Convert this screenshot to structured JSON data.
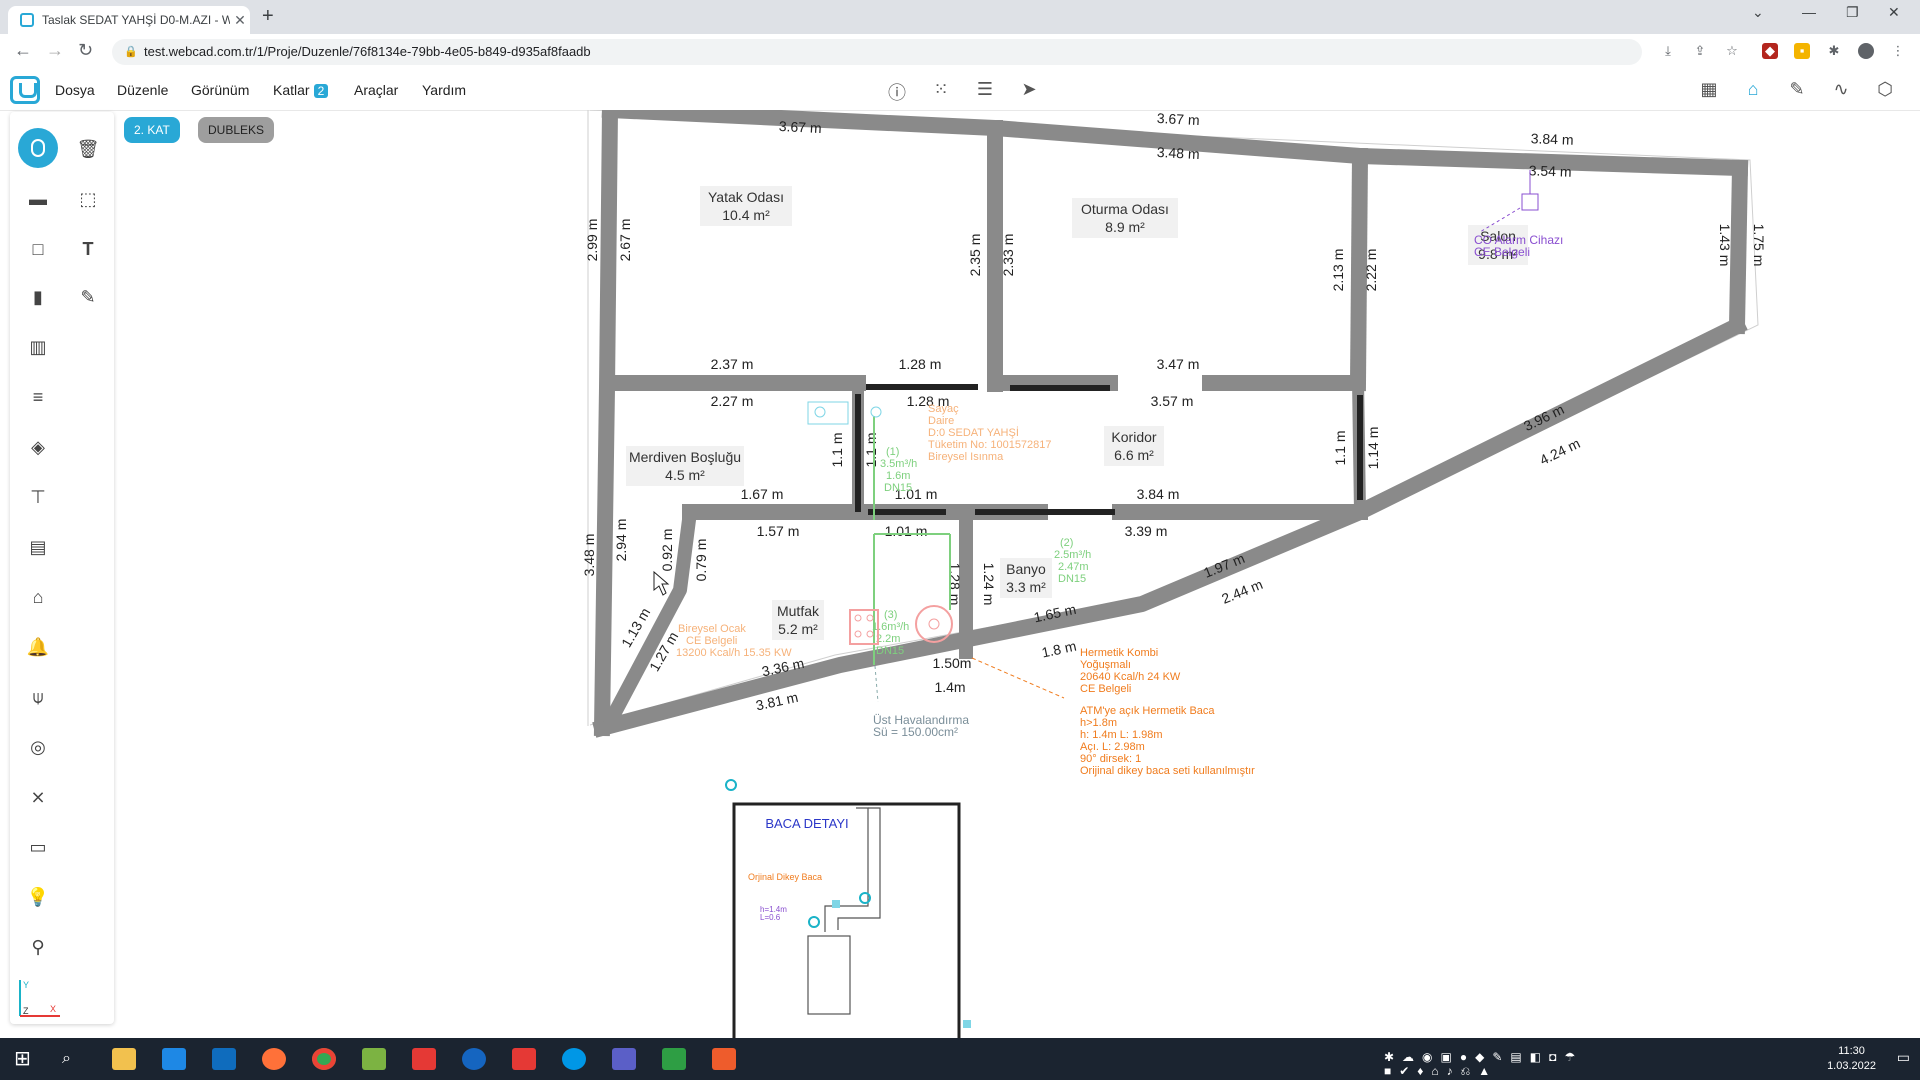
{
  "browser": {
    "tab_title": "Taslak SEDAT YAHŞİ D0-M.AZI - W",
    "new_tab": "+",
    "url": "test.webcad.com.tr/1/Proje/Duzenle/76f8134e-79bb-4e05-b849-d935af8faadb"
  },
  "menu": {
    "items": [
      "Dosya",
      "Düzenle",
      "Görünüm",
      "Katlar",
      "Araçlar",
      "Yardım"
    ],
    "katlar_badge": "2"
  },
  "floor_chips": {
    "active": "2. KAT",
    "other": "DUBLEKS"
  },
  "colors": {
    "accent": "#29a8d6",
    "wall": "#8a8a8a",
    "orange": "#f07c1e",
    "green": "#7ed07e",
    "purple": "#8a4fd0",
    "cyan": "#1ab3c8"
  },
  "rooms": {
    "yatak": {
      "name": "Yatak Odası",
      "area": "10.4 m²"
    },
    "oturma": {
      "name": "Oturma Odası",
      "area": "8.9 m²"
    },
    "salon": {
      "name": "Salon",
      "area": "9.8 m²"
    },
    "merdiven": {
      "name": "Merdiven Boşluğu",
      "area": "4.5 m²"
    },
    "koridor": {
      "name": "Koridor",
      "area": "6.6 m²"
    },
    "banyo": {
      "name": "Banyo",
      "area": "3.3 m²"
    },
    "mutfak": {
      "name": "Mutfak",
      "area": "5.2 m²"
    }
  },
  "dims": {
    "top1": "3.67 m",
    "top2": "3.67 m",
    "top3": "3.84 m",
    "in1": "3.48 m",
    "in2": "3.54 m",
    "mid1": "2.37 m",
    "mid2": "1.28 m",
    "mid3": "3.47 m",
    "mid4": "2.27 m",
    "mid5": "1.28 m",
    "mid6": "3.57 m",
    "low1": "1.67 m",
    "low2": "1.01 m",
    "low3": "3.84 m",
    "low4": "1.57 m",
    "low5": "1.01 m",
    "low6": "3.39 m",
    "v1": "2.99 m",
    "v2": "2.67 m",
    "v3": "2.35 m",
    "v4": "2.33 m",
    "v5": "2.13 m",
    "v6": "2.22 m",
    "v7": "1.43 m",
    "v8": "1.75 m",
    "v9": "1.1 m",
    "v10": "1.1 m",
    "v11": "1.1 m",
    "v12": "1.14 m",
    "v13": "3.48 m",
    "v14": "2.94 m",
    "v15": "0.92 m",
    "v16": "0.79 m",
    "v17": "1.24 m",
    "v18": "1.28 m",
    "d1": "3.96 m",
    "d2": "4.24 m",
    "d3": "1.97 m",
    "d4": "2.44 m",
    "d5": "1.65 m",
    "d6": "1.8 m",
    "d7": "1.13 m",
    "d8": "1.27 m",
    "d9": "3.36 m",
    "d10": "3.81 m",
    "d11": "1.50m",
    "d12": "1.4m"
  },
  "annotations": {
    "co": [
      "CO Alarm Cihazı",
      "CE Belgeli"
    ],
    "sayac": [
      "Sayaç",
      "Daire",
      "D:0 SEDAT YAHŞİ",
      "Tüketim No: 1001572817",
      "Bireysel Isınma"
    ],
    "pipe1": [
      "(1)",
      "3.5m³/h",
      "1.6m",
      "DN15"
    ],
    "pipe2": [
      "(2)",
      "2.5m³/h",
      "2.47m",
      "DN15"
    ],
    "pipe3": [
      "(3)",
      "1.6m³/h",
      "2.2m",
      "DN15"
    ],
    "ocak": [
      "Bireysel Ocak",
      "CE Belgeli",
      "13200 Kcal/h 15.35 KW"
    ],
    "kombi": [
      "Hermetik Kombi",
      "Yoğuşmalı",
      "20640 Kcal/h 24 KW",
      "CE Belgeli"
    ],
    "baca": [
      "ATM'ye açık Hermetik Baca",
      "h>1.8m",
      "h: 1.4m L: 1.98m",
      "Açı. L: 2.98m",
      "90° dirsek: 1",
      "Orijinal dikey baca seti kullanılmıştır"
    ],
    "havalandirma": [
      "Üst Havalandırma",
      "Sü = 150.00cm²"
    ]
  },
  "baca_detail": {
    "title": "BACA DETAYI",
    "label": "Orjinal Dikey Baca",
    "h": "h=1.4m",
    "l": "L=0.6"
  },
  "axis": {
    "y": "Y",
    "z": "Z",
    "x": "X"
  },
  "clock": {
    "time": "11:30",
    "date": "1.03.2022"
  }
}
